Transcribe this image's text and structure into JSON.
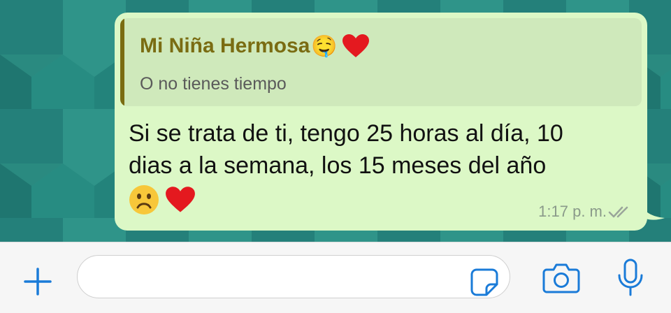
{
  "message": {
    "quote": {
      "author": "Mi Niña Hermosa",
      "author_emoji": "🤤",
      "text": "O no tienes tiempo"
    },
    "lines": [
      "Si se trata de ti, tengo 25 horas al día, 10",
      "dias a la semana, los 15 meses del año"
    ],
    "time": "1:17 p. m.",
    "status": "read"
  },
  "input_bar": {
    "placeholder": ""
  },
  "colors": {
    "chat_background": "#2a8a80",
    "bubble": "#dcf8c6",
    "quote_background": "#cfe9bb",
    "quote_accent": "#7a6c12",
    "icon_blue": "#1a7bd8",
    "heart": "#e4191f"
  }
}
